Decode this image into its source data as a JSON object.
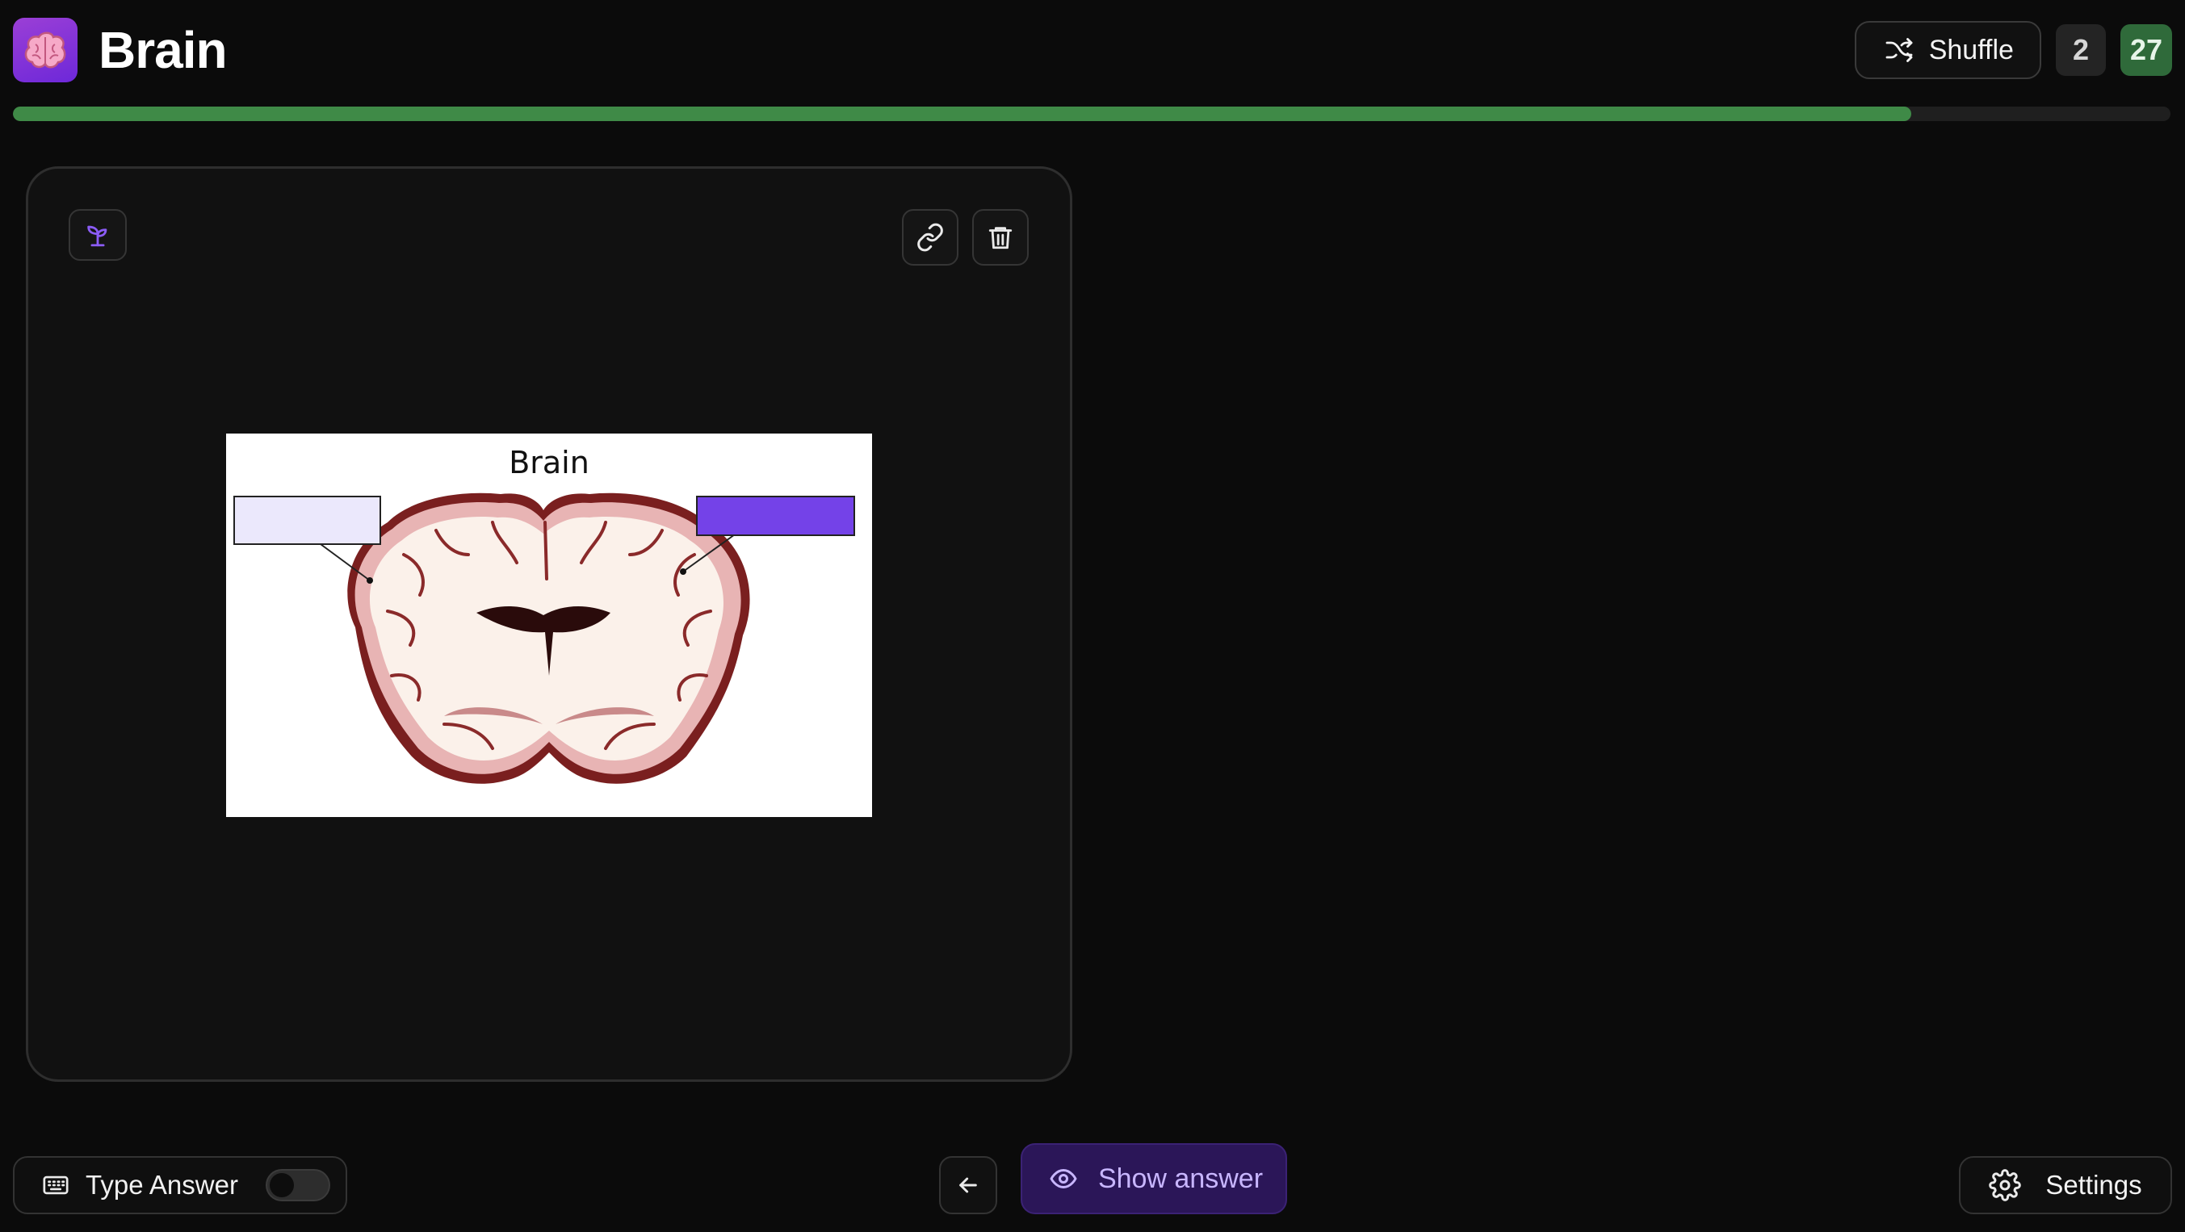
{
  "header": {
    "logo_icon": "brain-emoji",
    "title": "Brain",
    "shuffle_label": "Shuffle",
    "shuffle_icon": "shuffle-icon",
    "count_remaining": "2",
    "count_done": "27"
  },
  "progress": {
    "fraction": 0.88,
    "color": "#3f8a47"
  },
  "card": {
    "top_left_icon": "sprout-icon",
    "link_icon": "link-icon",
    "delete_icon": "trash-icon",
    "figure": {
      "title": "Brain",
      "left_label_fill": "#ebe8fc",
      "right_label_fill": "#7442e8"
    }
  },
  "bottom": {
    "type_answer_label": "Type Answer",
    "type_answer_icon": "keyboard-icon",
    "type_answer_on": false,
    "back_icon": "arrow-left-icon",
    "show_answer_label": "Show answer",
    "show_answer_icon": "eye-icon",
    "settings_label": "Settings",
    "settings_icon": "gear-icon"
  }
}
